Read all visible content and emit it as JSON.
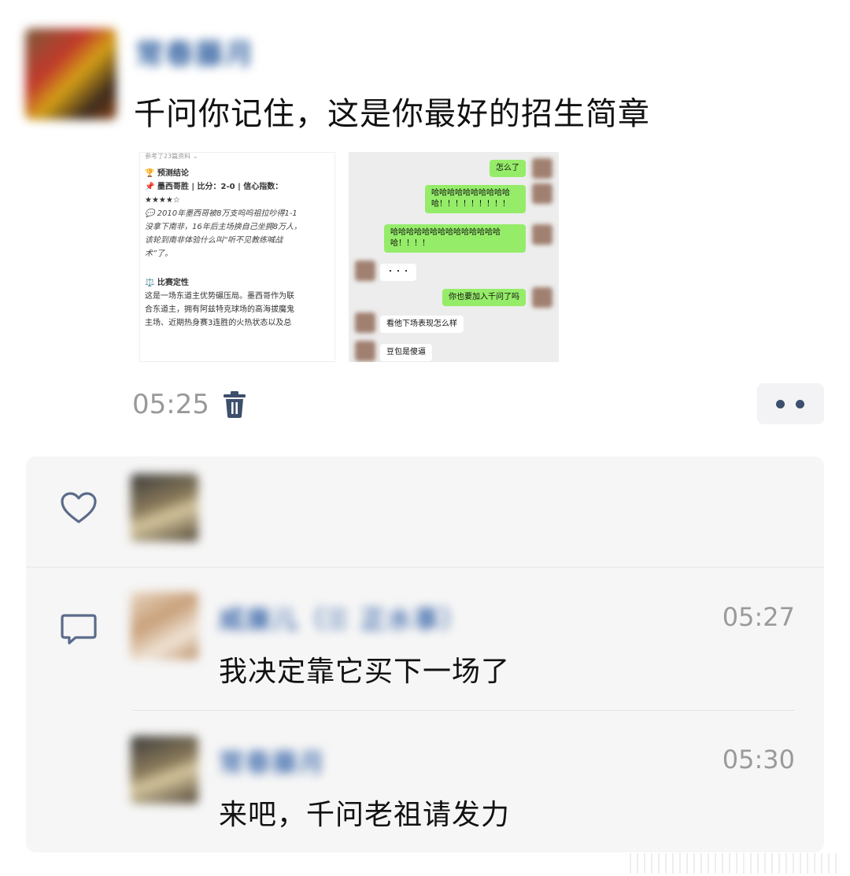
{
  "post": {
    "author_name": "常春藤月",
    "text": "千问你记住，这是你最好的招生简章",
    "time": "05:25"
  },
  "image1": {
    "header": "参考了23篇资料 ⌄",
    "section1_title": "🏆 预测结论",
    "pick": "📌 墨西哥胜 | 比分：2-0 | 信心指数：",
    "stars": "★★★★☆",
    "quote_lines": [
      "💬 2010年墨西哥被8万支呜呜祖拉吵得1-1",
      "没拿下南非，16年后主场换自己坐拥8万人，",
      "该轮到南非体验什么叫“听不见教练喊战",
      "术”了。"
    ],
    "section2_title": "⚖️ 比赛定性",
    "body_lines": [
      "这是一场东道主优势碾压局。墨西哥作为联",
      "合东道主，拥有阿兹特克球场的高海拔魔鬼",
      "主场、近期热身赛3连胜的火热状态以及总"
    ]
  },
  "image2": {
    "messages": [
      {
        "side": "right",
        "text": "怎么了"
      },
      {
        "side": "right",
        "text": "哈哈哈哈哈哈哈哈哈哈哈！！！！！！！！！"
      },
      {
        "side": "right",
        "text": "哈哈哈哈哈哈哈哈哈哈哈哈哈哈哈！！！！"
      },
      {
        "side": "left",
        "text": "・・・"
      },
      {
        "side": "right",
        "text": "你也要加入千问了吗"
      },
      {
        "side": "left",
        "text": "看他下场表现怎么样"
      },
      {
        "side": "left",
        "text": "豆包是傻逼"
      }
    ]
  },
  "interaction": {
    "comments": [
      {
        "name": "威廉儿（☰ 正水事）",
        "time": "05:27",
        "text": "我决定靠它买下一场了"
      },
      {
        "name": "常春藤月",
        "time": "05:30",
        "text": "来吧，千问老祖请发力"
      }
    ]
  },
  "icons": {
    "trash": "trash-icon",
    "more": "more-dots-icon",
    "like": "heart-icon",
    "comment": "comment-icon"
  },
  "colors": {
    "name_blue": "#4a73b0",
    "icon_navy": "#3d4f6d",
    "time_gray": "#999999",
    "panel_bg": "#f6f6f6",
    "wechat_green": "#95ec69"
  }
}
